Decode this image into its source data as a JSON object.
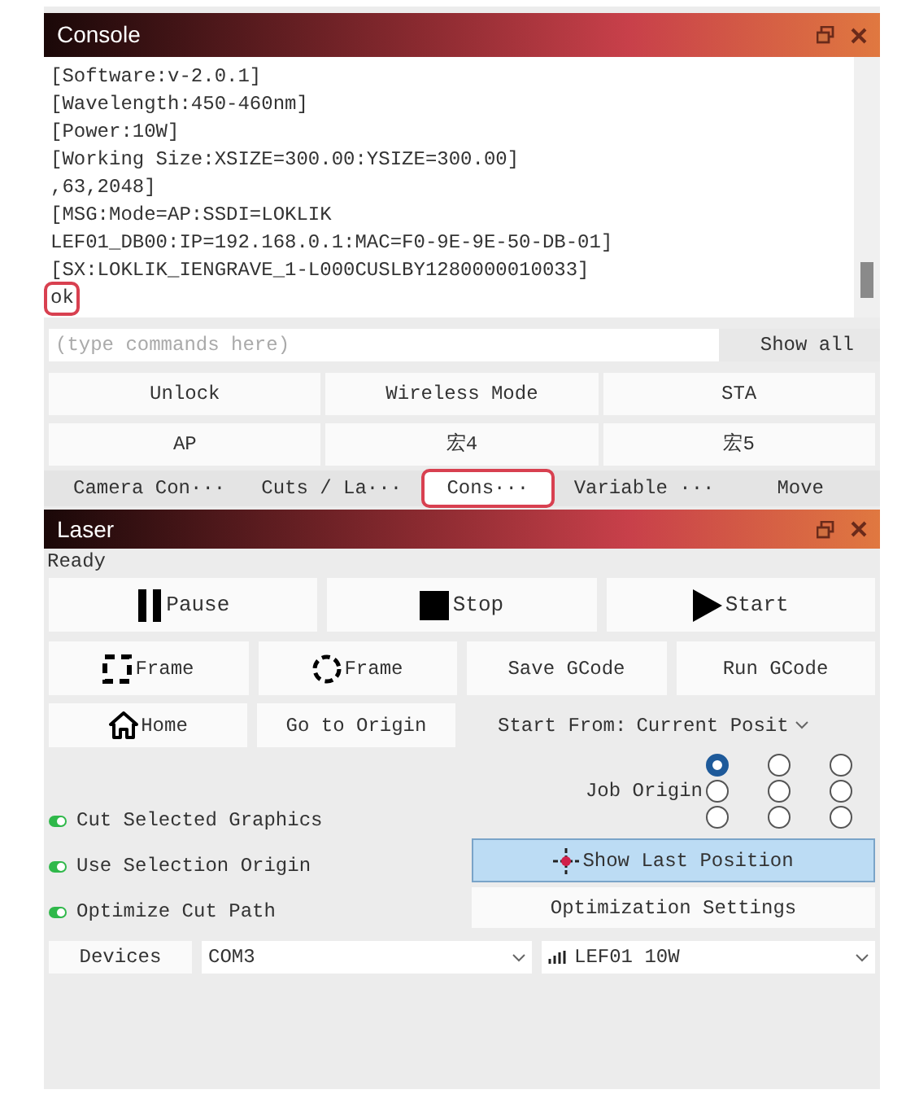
{
  "console": {
    "title": "Console",
    "lines": [
      {
        "text": "[Software:v-2.0.1]",
        "highlighted": false
      },
      {
        "text": "[Wavelength:450-460nm]",
        "highlighted": false
      },
      {
        "text": "[Power:10W]",
        "highlighted": false
      },
      {
        "text": "[Working Size:XSIZE=300.00:YSIZE=300.00]",
        "highlighted": false
      },
      {
        "text": ",63,2048]",
        "highlighted": false
      },
      {
        "text": "[MSG:Mode=AP:SSDI=LOKLIK",
        "highlighted": false
      },
      {
        "text": "LEF01_DB00:IP=192.168.0.1:MAC=F0-9E-9E-50-DB-01]",
        "highlighted": false
      },
      {
        "text": "[SX:LOKLIK_IENGRAVE_1-L000CUSLBY1280000010033]",
        "highlighted": false
      },
      {
        "text": "ok",
        "highlighted": true
      }
    ],
    "command": {
      "placeholder": "(type commands here)"
    },
    "show_all": "Show all",
    "macros": [
      "Unlock",
      "Wireless Mode",
      "STA",
      "AP",
      "宏4",
      "宏5"
    ]
  },
  "tabs": [
    {
      "label": "Camera Con···",
      "selected": false,
      "highlighted": false
    },
    {
      "label": "Cuts / La···",
      "selected": false,
      "highlighted": false
    },
    {
      "label": "Cons···",
      "selected": true,
      "highlighted": true
    },
    {
      "label": "Variable ···",
      "selected": false,
      "highlighted": false
    },
    {
      "label": "Move",
      "selected": false,
      "highlighted": false
    }
  ],
  "laser": {
    "title": "Laser",
    "status": "Ready",
    "main_buttons": [
      {
        "kind": "pause",
        "label": "Pause"
      },
      {
        "kind": "stop",
        "label": "Stop"
      },
      {
        "kind": "start",
        "label": "Start"
      }
    ],
    "frame_buttons": [
      {
        "kind": "frame-rect",
        "label": "Frame"
      },
      {
        "kind": "frame-circle",
        "label": "Frame"
      },
      {
        "kind": "plain",
        "label": "Save GCode"
      },
      {
        "kind": "plain",
        "label": "Run GCode"
      }
    ],
    "home": "Home",
    "go_to_origin": "Go to Origin",
    "start_from": {
      "label": "Start From:",
      "value": "Current Posit"
    },
    "job_origin": {
      "label": "Job Origin",
      "options": [
        {
          "selected": true
        },
        {
          "selected": false
        },
        {
          "selected": false
        },
        {
          "selected": false
        },
        {
          "selected": false
        },
        {
          "selected": false
        },
        {
          "selected": false
        },
        {
          "selected": false
        },
        {
          "selected": false
        }
      ]
    },
    "options": [
      {
        "label": "Cut Selected Graphics",
        "checked": true
      },
      {
        "label": "Use Selection Origin",
        "checked": true
      },
      {
        "label": "Optimize Cut Path",
        "checked": true
      }
    ],
    "show_last_position": "Show Last Position",
    "optimization_settings": "Optimization Settings",
    "devices": "Devices",
    "port": "COM3",
    "device": "LEF01 10W"
  }
}
